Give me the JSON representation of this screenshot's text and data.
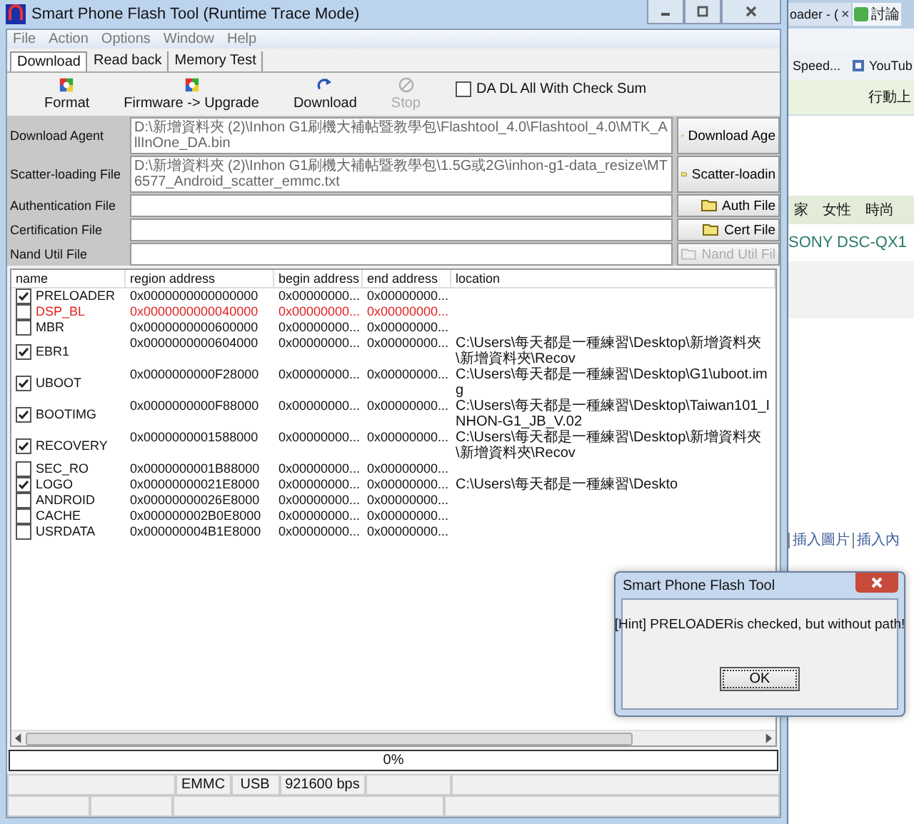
{
  "browser_background": {
    "tabs": [
      {
        "label": "oader - (",
        "close": "×",
        "selected": false
      },
      {
        "label": "討論",
        "selected": true
      }
    ],
    "bookmarks": [
      "Speed...",
      "YouTub"
    ],
    "nav_label": "行動上",
    "categories": [
      "家",
      "女性",
      "時尚"
    ],
    "headline": "SONY DSC-QX1",
    "editor_links": [
      "插入圖片",
      "插入內"
    ]
  },
  "main_window": {
    "title": "Smart Phone Flash Tool (Runtime Trace Mode)",
    "menu": [
      "File",
      "Action",
      "Options",
      "Window",
      "Help"
    ],
    "tabs": [
      {
        "label": "Download",
        "selected": true
      },
      {
        "label": "Read back",
        "selected": false
      },
      {
        "label": "Memory Test",
        "selected": false
      }
    ],
    "toolbar": [
      {
        "kind": "format",
        "label": "Format",
        "disabled": false
      },
      {
        "kind": "upgrade",
        "label": "Firmware -> Upgrade",
        "disabled": false
      },
      {
        "kind": "download",
        "label": "Download",
        "disabled": false
      },
      {
        "kind": "stop",
        "label": "Stop",
        "disabled": true
      }
    ],
    "checksum_option": {
      "label": "DA DL All With Check Sum",
      "checked": false
    },
    "file_rows": [
      {
        "label": "Download Agent",
        "value": "D:\\新增資料夾 (2)\\Inhon G1刷機大補帖暨教學包\\Flashtool_4.0\\Flashtool_4.0\\MTK_AllInOne_DA.bin",
        "button": "Download Age",
        "disabled": false
      },
      {
        "label": "Scatter-loading File",
        "value": "D:\\新增資料夾 (2)\\Inhon G1刷機大補帖暨教學包\\1.5G或2G\\inhon-g1-data_resize\\MT6577_Android_scatter_emmc.txt",
        "button": "Scatter-loadin",
        "disabled": false
      },
      {
        "label": "Authentication File",
        "button": "Auth File",
        "disabled": false
      },
      {
        "label": "Certification File",
        "button": "Cert File",
        "disabled": false
      },
      {
        "label": "Nand Util File",
        "button": "Nand Util Fil",
        "disabled": true
      }
    ],
    "table": {
      "columns": [
        "name",
        "region address",
        "begin address",
        "end address",
        "location"
      ],
      "rows": [
        {
          "name": "PRELOADER",
          "checked": true,
          "error": false,
          "region": "0x0000000000000000",
          "begin": "0x00000000...",
          "end": "0x00000000..."
        },
        {
          "name": "DSP_BL",
          "checked": false,
          "error": true,
          "region": "0x0000000000040000",
          "begin": "0x00000000...",
          "end": "0x00000000..."
        },
        {
          "name": "MBR",
          "checked": false,
          "error": false,
          "region": "0x0000000000600000",
          "begin": "0x00000000...",
          "end": "0x00000000..."
        },
        {
          "name": "EBR1",
          "checked": true,
          "error": false,
          "region": "0x0000000000604000",
          "begin": "0x00000000...",
          "end": "0x00000000...",
          "location": "C:\\Users\\每天都是一種練習\\Desktop\\新增資料夾\\新增資料夾\\Recov"
        },
        {
          "name": "UBOOT",
          "checked": true,
          "error": false,
          "region": "0x0000000000F28000",
          "begin": "0x00000000...",
          "end": "0x00000000...",
          "location": "C:\\Users\\每天都是一種練習\\Desktop\\G1\\uboot.img"
        },
        {
          "name": "BOOTIMG",
          "checked": true,
          "error": false,
          "region": "0x0000000000F88000",
          "begin": "0x00000000...",
          "end": "0x00000000...",
          "location": "C:\\Users\\每天都是一種練習\\Desktop\\Taiwan101_INHON-G1_JB_V.02"
        },
        {
          "name": "RECOVERY",
          "checked": true,
          "error": false,
          "region": "0x0000000001588000",
          "begin": "0x00000000...",
          "end": "0x00000000...",
          "location": "C:\\Users\\每天都是一種練習\\Desktop\\新增資料夾\\新增資料夾\\Recov"
        },
        {
          "name": "SEC_RO",
          "checked": false,
          "error": false,
          "region": "0x0000000001B88000",
          "begin": "0x00000000...",
          "end": "0x00000000..."
        },
        {
          "name": "LOGO",
          "checked": true,
          "error": false,
          "region": "0x00000000021E8000",
          "begin": "0x00000000...",
          "end": "0x00000000...",
          "location": "C:\\Users\\每天都是一種練習\\Deskto"
        },
        {
          "name": "ANDROID",
          "checked": false,
          "error": false,
          "region": "0x00000000026E8000",
          "begin": "0x00000000...",
          "end": "0x00000000..."
        },
        {
          "name": "CACHE",
          "checked": false,
          "error": false,
          "region": "0x000000002B0E8000",
          "begin": "0x00000000...",
          "end": "0x00000000..."
        },
        {
          "name": "USRDATA",
          "checked": false,
          "error": false,
          "region": "0x000000004B1E8000",
          "begin": "0x00000000...",
          "end": "0x00000000..."
        }
      ]
    },
    "progress": {
      "text": "0%",
      "level": 0
    },
    "status_bar": [
      "EMMC",
      "USB",
      "921600 bps"
    ]
  },
  "dialog": {
    "title": "Smart Phone Flash Tool",
    "message": "[Hint] PRELOADERis checked, but without path!",
    "button": "OK"
  }
}
